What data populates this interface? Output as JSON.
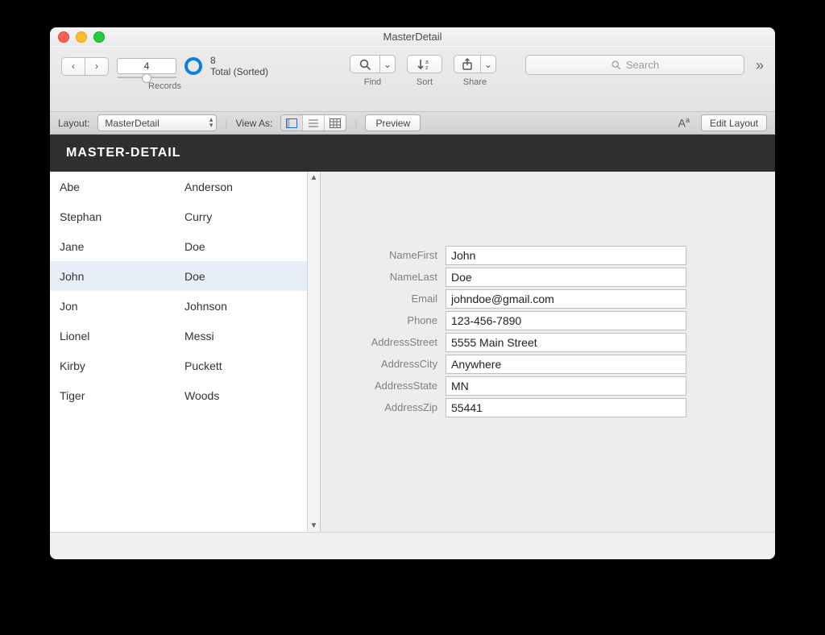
{
  "window": {
    "title": "MasterDetail"
  },
  "toolbar": {
    "records_label": "Records",
    "page_number": "4",
    "total_count": "8",
    "total_label": "Total (Sorted)",
    "find_label": "Find",
    "sort_label": "Sort",
    "share_label": "Share",
    "search_placeholder": "Search"
  },
  "subbar": {
    "layout_label": "Layout:",
    "layout_name": "MasterDetail",
    "viewas_label": "View As:",
    "preview_label": "Preview",
    "edit_layout_label": "Edit Layout"
  },
  "header": {
    "title": "MASTER-DETAIL"
  },
  "master": {
    "rows": [
      {
        "first": "Abe",
        "last": "Anderson",
        "selected": false
      },
      {
        "first": "Stephan",
        "last": "Curry",
        "selected": false
      },
      {
        "first": "Jane",
        "last": "Doe",
        "selected": false
      },
      {
        "first": "John",
        "last": "Doe",
        "selected": true
      },
      {
        "first": "Jon",
        "last": "Johnson",
        "selected": false
      },
      {
        "first": "Lionel",
        "last": "Messi",
        "selected": false
      },
      {
        "first": "Kirby",
        "last": "Puckett",
        "selected": false
      },
      {
        "first": "Tiger",
        "last": "Woods",
        "selected": false
      }
    ]
  },
  "detail": {
    "fields": [
      {
        "label": "NameFirst",
        "value": "John"
      },
      {
        "label": "NameLast",
        "value": "Doe"
      },
      {
        "label": "Email",
        "value": "johndoe@gmail.com"
      },
      {
        "label": "Phone",
        "value": "123-456-7890"
      },
      {
        "label": "AddressStreet",
        "value": "5555 Main Street"
      },
      {
        "label": "AddressCity",
        "value": "Anywhere"
      },
      {
        "label": "AddressState",
        "value": "MN"
      },
      {
        "label": "AddressZip",
        "value": "55441"
      }
    ]
  }
}
